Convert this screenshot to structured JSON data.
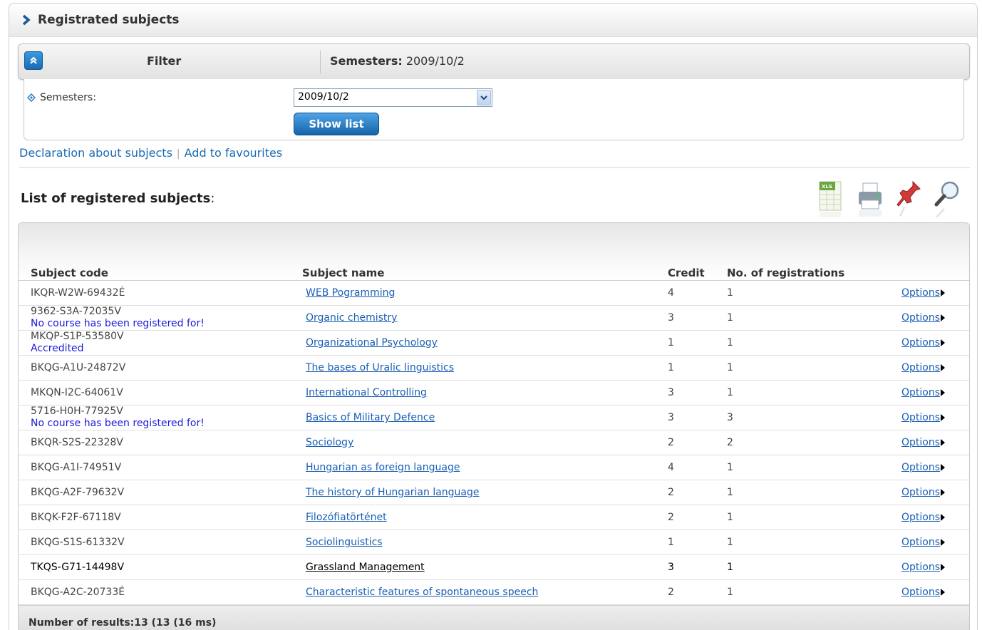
{
  "page": {
    "title": "Registrated subjects"
  },
  "filter": {
    "label": "Filter",
    "summary_key": "Semesters:",
    "summary_value": " 2009/10/2",
    "semesters_label": "Semesters:",
    "semesters_value": "2009/10/2",
    "show_button": "Show list"
  },
  "links": {
    "declaration": "Declaration about subjects",
    "separator": "|",
    "favourites": "Add to favourites"
  },
  "list": {
    "title": "List of registered subjects",
    "title_colon": ":",
    "toolbar": [
      "xls-export-icon",
      "print-icon",
      "pin-icon",
      "search-icon"
    ],
    "columns": {
      "code": "Subject code",
      "name": "Subject name",
      "credit": "Credit",
      "registrations": "No. of registrations"
    },
    "rows": [
      {
        "code": "IKQR-W2W-69432É",
        "note": "",
        "name": "WEB Pogramming",
        "credit": "4",
        "registrations": "1",
        "options": "Options"
      },
      {
        "code": "9362-S3A-72035V",
        "note": "No course has been registered for!",
        "name": "Organic chemistry",
        "credit": "3",
        "registrations": "1",
        "options": "Options"
      },
      {
        "code": "MKQP-S1P-53580V",
        "note": "Accredited",
        "name": "Organizational Psychology",
        "credit": "1",
        "registrations": "1",
        "options": "Options"
      },
      {
        "code": "BKQG-A1U-24872V",
        "note": "",
        "name": "The bases of Uralic linguistics",
        "credit": "1",
        "registrations": "1",
        "options": "Options"
      },
      {
        "code": "MKQN-I2C-64061V",
        "note": "",
        "name": "International Controlling",
        "credit": "3",
        "registrations": "1",
        "options": "Options"
      },
      {
        "code": "5716-H0H-77925V",
        "note": "No course has been registered for!",
        "name": "Basics of Military Defence",
        "credit": "3",
        "registrations": "3",
        "options": "Options"
      },
      {
        "code": "BKQR-S2S-22328V",
        "note": "",
        "name": "Sociology",
        "credit": "2",
        "registrations": "2",
        "options": "Options"
      },
      {
        "code": "BKQG-A1I-74951V",
        "note": "",
        "name": "Hungarian as foreign language",
        "credit": "4",
        "registrations": "1",
        "options": "Options"
      },
      {
        "code": "BKQG-A2F-79632V",
        "note": "",
        "name": "The history of Hungarian language",
        "credit": "2",
        "registrations": "1",
        "options": "Options"
      },
      {
        "code": "BKQK-F2F-67118V",
        "note": "",
        "name": "Filozófiatörténet",
        "credit": "2",
        "registrations": "1",
        "options": "Options"
      },
      {
        "code": "BKQG-S1S-61332V",
        "note": "",
        "name": "Sociolinguistics",
        "credit": "1",
        "registrations": "1",
        "options": "Options"
      },
      {
        "code": "TKQS-G71-14498V",
        "note": "",
        "name": "Grassland Management",
        "credit": "3",
        "registrations": "1",
        "options": "Options"
      },
      {
        "code": "BKQG-A2C-20733É",
        "note": "",
        "name": "Characteristic features of spontaneous speech",
        "credit": "2",
        "registrations": "1",
        "options": "Options"
      }
    ],
    "footer": "Number of results:13 (13 (16 ms)"
  }
}
